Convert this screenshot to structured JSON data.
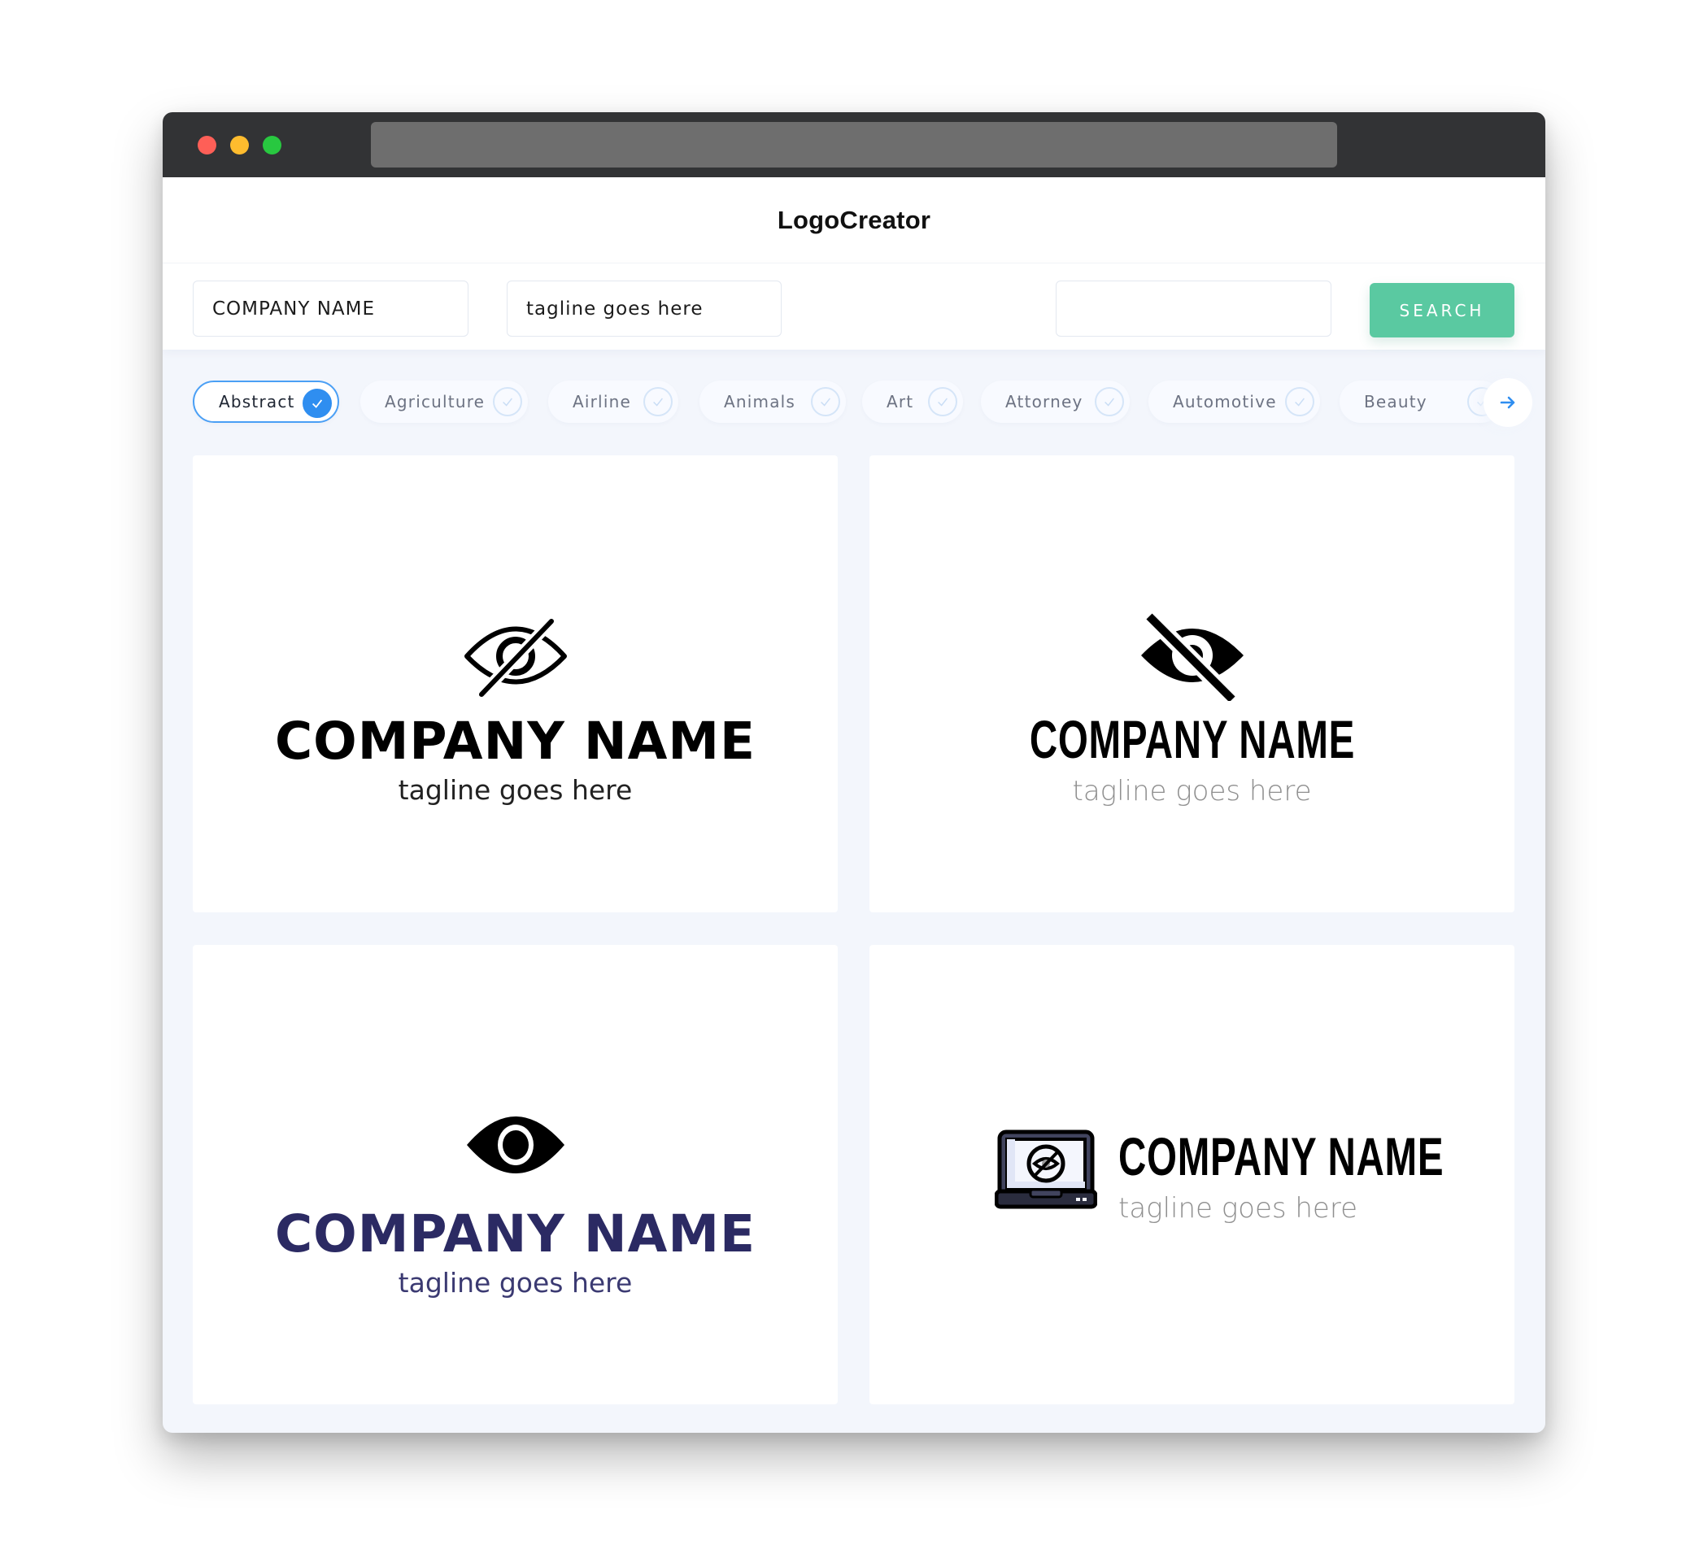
{
  "window": {
    "traffic_lights": [
      "close",
      "minimize",
      "maximize"
    ]
  },
  "header": {
    "brand": "LogoCreator"
  },
  "search": {
    "company_name_value": "COMPANY NAME",
    "tagline_value": "tagline goes here",
    "keyword_value": "",
    "button_label": "SEARCH",
    "button_color": "#5ac9a1"
  },
  "categories": {
    "items": [
      {
        "label": "Abstract",
        "selected": true
      },
      {
        "label": "Agriculture",
        "selected": false
      },
      {
        "label": "Airline",
        "selected": false
      },
      {
        "label": "Animals",
        "selected": false
      },
      {
        "label": "Art",
        "selected": false
      },
      {
        "label": "Attorney",
        "selected": false
      },
      {
        "label": "Automotive",
        "selected": false
      },
      {
        "label": "Beauty",
        "selected": false
      }
    ],
    "next_icon": "arrow-right-icon",
    "accent_color": "#2f8ef0"
  },
  "logos": [
    {
      "icon": "eye-slash-outline-icon",
      "name": "COMPANY NAME",
      "tagline": "tagline goes here",
      "name_color": "#000000",
      "tagline_color": "#222222"
    },
    {
      "icon": "eye-slash-filled-icon",
      "name": "COMPANY NAME",
      "tagline": "tagline goes here",
      "name_color": "#000000",
      "tagline_color": "#8f8f8f"
    },
    {
      "icon": "eye-filled-icon",
      "name": "COMPANY NAME",
      "tagline": "tagline goes here",
      "name_color": "#2b2a63",
      "tagline_color": "#3b3a72"
    },
    {
      "icon": "laptop-eye-slash-icon",
      "name": "COMPANY NAME",
      "tagline": "tagline goes here",
      "name_color": "#000000",
      "tagline_color": "#8f8f8f"
    }
  ]
}
